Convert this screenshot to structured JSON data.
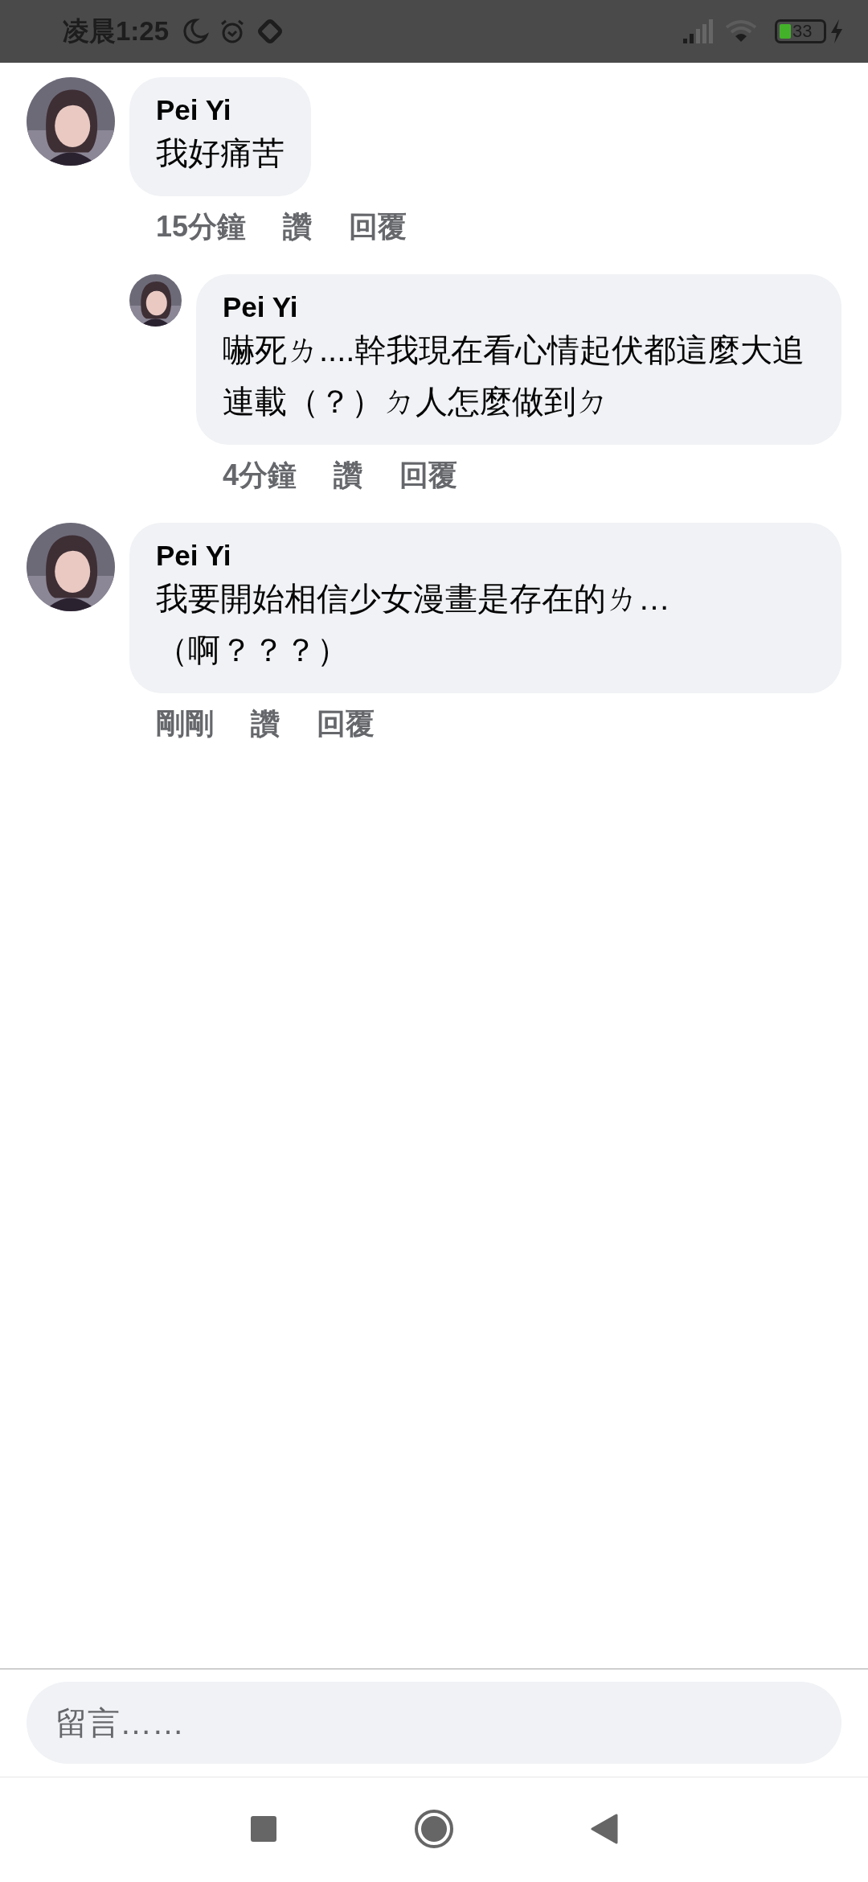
{
  "status_bar": {
    "time": "凌晨1:25",
    "battery": "33"
  },
  "comments": [
    {
      "kind": "comment",
      "author": "Pei Yi",
      "text": "我好痛苦",
      "time": "15分鐘",
      "like": "讚",
      "reply": "回覆"
    },
    {
      "kind": "reply",
      "author": "Pei Yi",
      "text": "嚇死ㄌ....幹我現在看心情起伏都這麼大追連載（？）ㄉ人怎麼做到ㄉ",
      "time": "4分鐘",
      "like": "讚",
      "reply": "回覆"
    },
    {
      "kind": "comment",
      "author": "Pei Yi",
      "text": "我要開始相信少女漫畫是存在的ㄌ…（啊？？？）",
      "time": "剛剛",
      "like": "讚",
      "reply": "回覆"
    }
  ],
  "composer": {
    "placeholder": "留言……"
  }
}
